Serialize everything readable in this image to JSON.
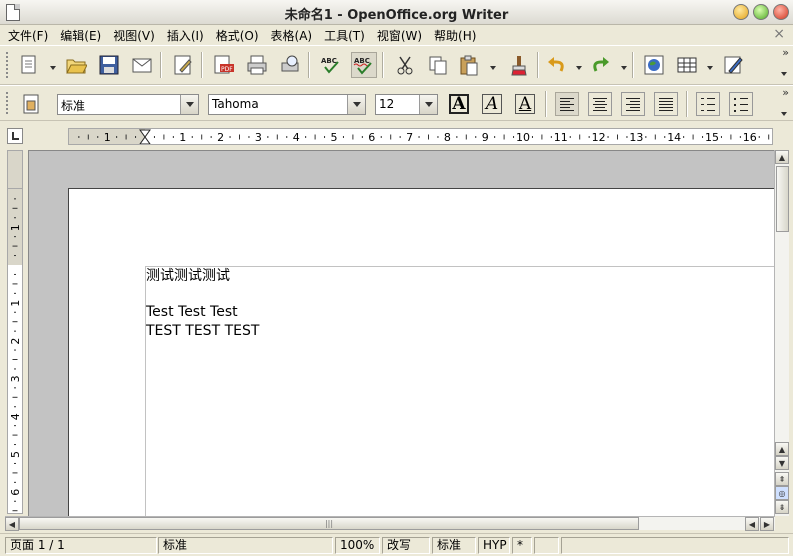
{
  "window": {
    "title": "未命名1 - OpenOffice.org Writer"
  },
  "menu": [
    "文件(F)",
    "编辑(E)",
    "视图(V)",
    "插入(I)",
    "格式(O)",
    "表格(A)",
    "工具(T)",
    "视窗(W)",
    "帮助(H)"
  ],
  "menu_close": "×",
  "formatting": {
    "paragraph_style": "标准",
    "font_name": "Tahoma",
    "font_size": "12",
    "bold_label": "A",
    "italic_label": "A",
    "underline_label": "A"
  },
  "hruler_labels": [
    "1",
    "1",
    "2",
    "3",
    "4",
    "5",
    "6",
    "7",
    "8",
    "9",
    "10",
    "11",
    "12",
    "13",
    "14",
    "15",
    "16"
  ],
  "vruler_labels": [
    "1",
    "1",
    "2",
    "3",
    "4",
    "5",
    "6"
  ],
  "document": {
    "lines": [
      "测试测试测试",
      "Test Test Test",
      "TEST TEST TEST"
    ]
  },
  "status": {
    "page": "页面 1 / 1",
    "style": "标准",
    "zoom": "100%",
    "insert_mode": "改写",
    "selection_mode": "标准",
    "hyphenation": "HYP",
    "modified": "*"
  },
  "colors": {
    "page_bg": "#ffffff",
    "workspace": "#c3c3c3",
    "chrome": "#ece9d8"
  }
}
